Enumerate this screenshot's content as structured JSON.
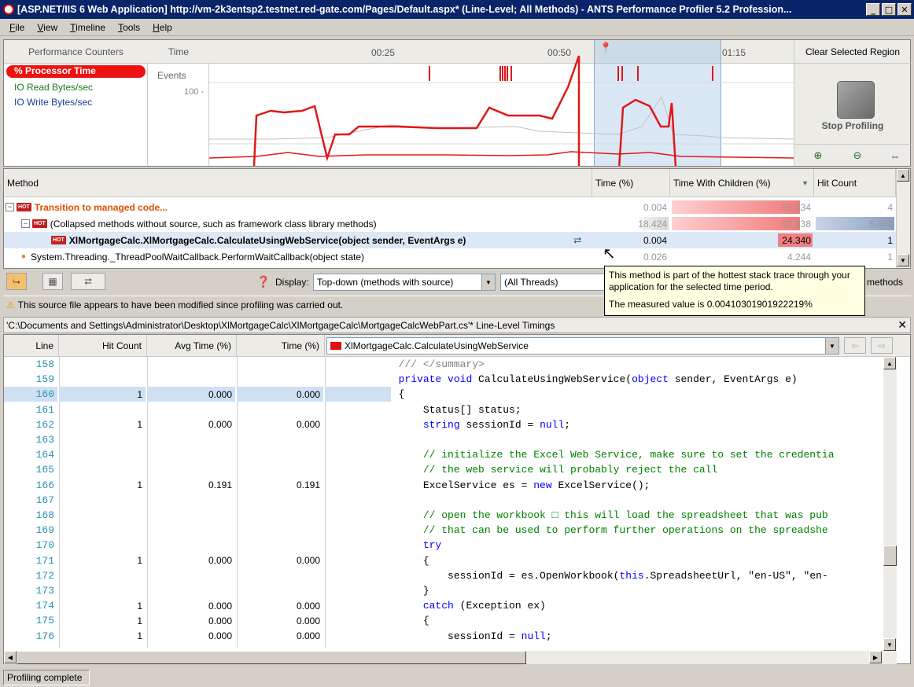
{
  "window": {
    "title": "[ASP.NET/IIS 6 Web Application] http://vm-2k3entsp2.testnet.red-gate.com/Pages/Default.aspx* (Line-Level; All Methods) - ANTS Performance Profiler 5.2 Profession...",
    "minimize": "_",
    "maximize": "□",
    "close": "✕"
  },
  "menu": [
    "File",
    "View",
    "Timeline",
    "Tools",
    "Help"
  ],
  "timeline": {
    "counters_header": "Performance Counters",
    "counters": [
      "% Processor Time",
      "IO Read Bytes/sec",
      "IO Write Bytes/sec"
    ],
    "time_header": "Time",
    "events_label": "Events",
    "y_label": "100 -",
    "ticks": [
      "00:25",
      "00:50",
      "01:15"
    ],
    "clear_region": "Clear Selected Region",
    "stop_profiling": "Stop Profiling",
    "colors": {
      "processor": "#e01818",
      "io_read": "#1a7a1a",
      "io_write": "#1a3c9a",
      "selection": "#96bee6"
    }
  },
  "methods": {
    "headers": {
      "method": "Method",
      "time": "Time (%)",
      "time_children": "Time With Children (%)",
      "hit_count": "Hit Count"
    },
    "sort_indicator": "▼",
    "rows": [
      {
        "name": "Transition to managed code...",
        "time": "0.004",
        "time_children": "91.034",
        "hit_count": "4",
        "hot": true,
        "tc_fraction": 0.91,
        "hc_fraction": 0.0
      },
      {
        "name": "(Collapsed methods without source, such as framework class library methods)",
        "time": "18.424",
        "time_children": "90.938",
        "hit_count": "6,451",
        "hot": true,
        "tc_fraction": 0.909,
        "hc_fraction": 1.0
      },
      {
        "name": "XlMortgageCalc.XlMortgageCalc.CalculateUsingWebService(object sender, EventArgs e)",
        "time": "0.004",
        "time_children": "24.340",
        "hit_count": "1",
        "hot": true,
        "tc_fraction": 0.243,
        "hc_fraction": 0.0
      },
      {
        "name": "System.Threading._ThreadPoolWaitCallback.PerformWaitCallback(object state)",
        "time": "0.026",
        "time_children": "4.244",
        "hit_count": "1",
        "hot": false,
        "tc_fraction": 0.042,
        "hc_fraction": 0.0
      }
    ],
    "hot_badge": "HOT"
  },
  "toolbar": {
    "display_label": "Display:",
    "display_value": "Top-down (methods with source)",
    "threads_value": "(All Threads)",
    "methods_label": "methods"
  },
  "tooltip": {
    "line1": "This method is part of the hottest stack trace through your application for the selected time period.",
    "line2": "The measured value is 0.00410301901922219%"
  },
  "warning": "This source file appears to have been modified since profiling was carried out.",
  "source_path": "'C:\\Documents and Settings\\Administrator\\Desktop\\XlMortgageCalc\\XlMortgageCalc\\MortgageCalcWebPart.cs'* Line-Level Timings",
  "code": {
    "headers": {
      "line": "Line",
      "hit_count": "Hit Count",
      "avg_time": "Avg Time (%)",
      "time": "Time (%)"
    },
    "method_select": "XlMortgageCalc.CalculateUsingWebService",
    "lines": [
      {
        "n": "158",
        "hc": "",
        "avg": "",
        "t": "",
        "code": [
          {
            "t": "            /// </summary>",
            "k": "gray"
          }
        ]
      },
      {
        "n": "159",
        "hc": "",
        "avg": "",
        "t": "",
        "code": [
          {
            "t": "            ",
            "k": ""
          },
          {
            "t": "private void",
            "k": "kw"
          },
          {
            "t": " CalculateUsingWebService(",
            "k": ""
          },
          {
            "t": "object",
            "k": "kw"
          },
          {
            "t": " sender, EventArgs e)",
            "k": ""
          }
        ]
      },
      {
        "n": "160",
        "hc": "1",
        "avg": "0.000",
        "t": "0.000",
        "hl": true,
        "code": [
          {
            "t": "            {",
            "k": ""
          }
        ]
      },
      {
        "n": "161",
        "hc": "",
        "avg": "",
        "t": "",
        "code": [
          {
            "t": "                Status[] status;",
            "k": ""
          }
        ]
      },
      {
        "n": "162",
        "hc": "1",
        "avg": "0.000",
        "t": "0.000",
        "code": [
          {
            "t": "                ",
            "k": ""
          },
          {
            "t": "string",
            "k": "kw"
          },
          {
            "t": " sessionId = ",
            "k": ""
          },
          {
            "t": "null",
            "k": "kw"
          },
          {
            "t": ";",
            "k": ""
          }
        ]
      },
      {
        "n": "163",
        "hc": "",
        "avg": "",
        "t": "",
        "code": []
      },
      {
        "n": "164",
        "hc": "",
        "avg": "",
        "t": "",
        "code": [
          {
            "t": "                // initialize the Excel Web Service, make sure to set the credentia",
            "k": "cm"
          }
        ]
      },
      {
        "n": "165",
        "hc": "",
        "avg": "",
        "t": "",
        "code": [
          {
            "t": "                // the web service will probably reject the call",
            "k": "cm"
          }
        ]
      },
      {
        "n": "166",
        "hc": "1",
        "avg": "0.191",
        "t": "0.191",
        "code": [
          {
            "t": "                ExcelService es = ",
            "k": ""
          },
          {
            "t": "new",
            "k": "kw"
          },
          {
            "t": " ExcelService();",
            "k": ""
          }
        ]
      },
      {
        "n": "167",
        "hc": "",
        "avg": "",
        "t": "",
        "code": []
      },
      {
        "n": "168",
        "hc": "",
        "avg": "",
        "t": "",
        "code": [
          {
            "t": "                // open the workbook □ this will load the spreadsheet that was pub",
            "k": "cm"
          }
        ]
      },
      {
        "n": "169",
        "hc": "",
        "avg": "",
        "t": "",
        "code": [
          {
            "t": "                // that can be used to perform further operations on the spreadshe",
            "k": "cm"
          }
        ]
      },
      {
        "n": "170",
        "hc": "",
        "avg": "",
        "t": "",
        "code": [
          {
            "t": "                ",
            "k": ""
          },
          {
            "t": "try",
            "k": "kw"
          }
        ]
      },
      {
        "n": "171",
        "hc": "1",
        "avg": "0.000",
        "t": "0.000",
        "code": [
          {
            "t": "                {",
            "k": ""
          }
        ]
      },
      {
        "n": "172",
        "hc": "",
        "avg": "",
        "t": "",
        "code": [
          {
            "t": "                    sessionId = es.OpenWorkbook(",
            "k": ""
          },
          {
            "t": "this",
            "k": "kw"
          },
          {
            "t": ".SpreadsheetUrl, \"en-US\", \"en-",
            "k": ""
          }
        ]
      },
      {
        "n": "173",
        "hc": "",
        "avg": "",
        "t": "",
        "code": [
          {
            "t": "                }",
            "k": ""
          }
        ]
      },
      {
        "n": "174",
        "hc": "1",
        "avg": "0.000",
        "t": "0.000",
        "code": [
          {
            "t": "                ",
            "k": ""
          },
          {
            "t": "catch",
            "k": "kw"
          },
          {
            "t": " (Exception ex)",
            "k": ""
          }
        ]
      },
      {
        "n": "175",
        "hc": "1",
        "avg": "0.000",
        "t": "0.000",
        "code": [
          {
            "t": "                {",
            "k": ""
          }
        ]
      },
      {
        "n": "176",
        "hc": "1",
        "avg": "0.000",
        "t": "0.000",
        "code": [
          {
            "t": "                    sessionId = ",
            "k": ""
          },
          {
            "t": "null",
            "k": "kw"
          },
          {
            "t": ";",
            "k": ""
          }
        ]
      }
    ]
  },
  "status": "Profiling complete"
}
